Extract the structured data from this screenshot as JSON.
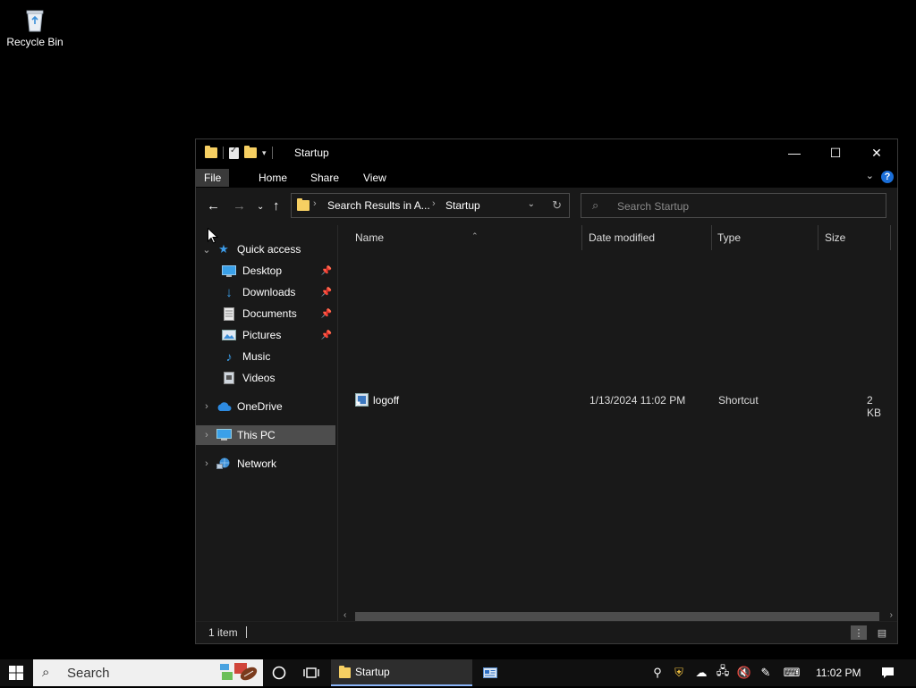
{
  "desktop": {
    "recycle_bin_label": "Recycle Bin"
  },
  "window": {
    "title": "Startup",
    "controls": {
      "minimize": "—",
      "maximize": "☐",
      "close": "✕"
    }
  },
  "ribbon": {
    "tabs": [
      "File",
      "Home",
      "Share",
      "View"
    ]
  },
  "address_bar": {
    "crumbs": [
      "Search Results in A...",
      "Startup"
    ]
  },
  "search": {
    "placeholder": "Search Startup"
  },
  "nav_pane": {
    "quick_access": "Quick access",
    "pinned": [
      "Desktop",
      "Downloads",
      "Documents",
      "Pictures"
    ],
    "unpinned": [
      "Music",
      "Videos"
    ],
    "roots": [
      "OneDrive",
      "This PC",
      "Network"
    ]
  },
  "columns": {
    "name": "Name",
    "date_modified": "Date modified",
    "type": "Type",
    "size": "Size"
  },
  "files": [
    {
      "name": "logoff",
      "date_modified": "1/13/2024 11:02 PM",
      "type": "Shortcut",
      "size": "2 KB"
    }
  ],
  "status": {
    "item_count": "1 item"
  },
  "taskbar": {
    "search_label": "Search",
    "app_label": "Startup",
    "clock": "11:02 PM"
  }
}
